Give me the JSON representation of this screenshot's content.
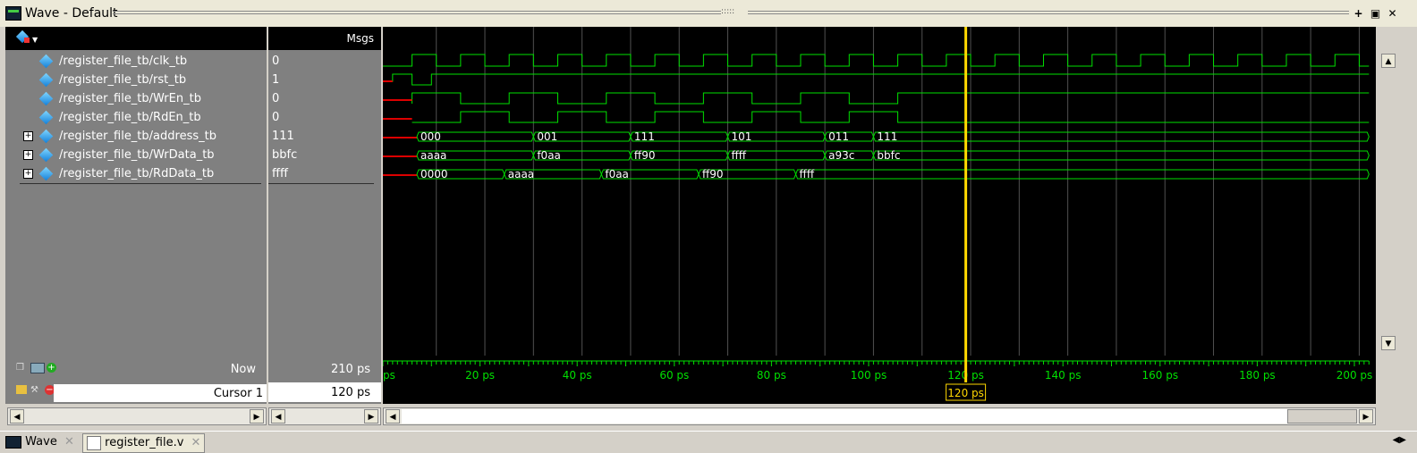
{
  "window": {
    "title": "Wave - Default",
    "grip": ":::::"
  },
  "header": {
    "msgs": "Msgs"
  },
  "signals": [
    {
      "name": "/register_file_tb/clk_tb",
      "value": "0",
      "expandable": false
    },
    {
      "name": "/register_file_tb/rst_tb",
      "value": "1",
      "expandable": false
    },
    {
      "name": "/register_file_tb/WrEn_tb",
      "value": "0",
      "expandable": false
    },
    {
      "name": "/register_file_tb/RdEn_tb",
      "value": "0",
      "expandable": false
    },
    {
      "name": "/register_file_tb/address_tb",
      "value": "111",
      "expandable": true
    },
    {
      "name": "/register_file_tb/WrData_tb",
      "value": "bbfc",
      "expandable": true
    },
    {
      "name": "/register_file_tb/RdData_tb",
      "value": "ffff",
      "expandable": true
    }
  ],
  "bus_labels": {
    "address": [
      {
        "t": 7,
        "v": "000"
      },
      {
        "t": 31,
        "v": "001"
      },
      {
        "t": 51,
        "v": "111"
      },
      {
        "t": 71,
        "v": "101"
      },
      {
        "t": 91,
        "v": "011"
      },
      {
        "t": 101,
        "v": "111"
      }
    ],
    "wrdata": [
      {
        "t": 7,
        "v": "aaaa"
      },
      {
        "t": 31,
        "v": "f0aa"
      },
      {
        "t": 51,
        "v": "ff90"
      },
      {
        "t": 71,
        "v": "ffff"
      },
      {
        "t": 91,
        "v": "a93c"
      },
      {
        "t": 101,
        "v": "bbfc"
      }
    ],
    "rddata": [
      {
        "t": 7,
        "v": "0000"
      },
      {
        "t": 25,
        "v": "aaaa"
      },
      {
        "t": 45,
        "v": "f0aa"
      },
      {
        "t": 65,
        "v": "ff90"
      },
      {
        "t": 85,
        "v": "ffff"
      }
    ]
  },
  "waves": {
    "wren": [
      0,
      1,
      0,
      1,
      0,
      1,
      0,
      1,
      0,
      1,
      0
    ],
    "rden": [
      0,
      1,
      0,
      1,
      0,
      1,
      0,
      1,
      0,
      1,
      0
    ]
  },
  "timeline": {
    "now_label": "Now",
    "now_value": "210 ps",
    "cursor_label": "Cursor 1",
    "cursor_value": "120 ps",
    "cursor_time": 120,
    "start_label": "ps",
    "ticks": [
      {
        "t": 20,
        "l": "20 ps"
      },
      {
        "t": 40,
        "l": "40 ps"
      },
      {
        "t": 60,
        "l": "60 ps"
      },
      {
        "t": 80,
        "l": "80 ps"
      },
      {
        "t": 100,
        "l": "100 ps"
      },
      {
        "t": 120,
        "l": "120 ps"
      },
      {
        "t": 140,
        "l": "140 ps"
      },
      {
        "t": 160,
        "l": "160 ps"
      },
      {
        "t": 180,
        "l": "180 ps"
      },
      {
        "t": 200,
        "l": "200 ps"
      }
    ],
    "range": [
      0,
      203
    ]
  },
  "tabs": [
    {
      "label": "Wave"
    },
    {
      "label": "register_file.v"
    }
  ],
  "colors": {
    "wave": "#00e000",
    "cursor": "#ffd700",
    "grid": "#505050"
  }
}
